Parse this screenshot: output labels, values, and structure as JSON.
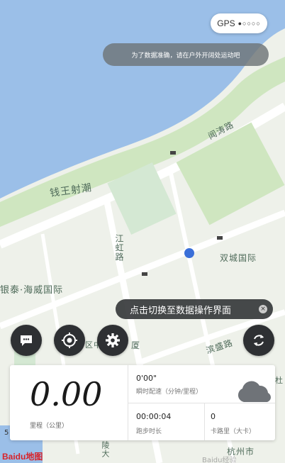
{
  "gps": {
    "label": "GPS",
    "signal_dots": "●○○○○"
  },
  "toast": {
    "text": "为了数据准确，请在户外开阔处运动吧"
  },
  "switch_hint": {
    "text": "点击切换至数据操作界面",
    "close_glyph": "×"
  },
  "map": {
    "labels": {
      "qiantang": "钱王射潮",
      "wenchao_road": "闻涛路",
      "jiangdong_road": "江虹路",
      "shuangcheng": "双城国际",
      "yintai": "银泰·海威国际",
      "binsheng": "滨盛路",
      "hangzhou": "杭州市",
      "jiang_ave": "江陵大",
      "bottom_road": "区中心路",
      "shangxia": "厦",
      "top_corner": "杜",
      "right_fragment": "路"
    },
    "scale_label": "5",
    "logo": "Baidu地图",
    "colors": {
      "water": "#9bbfe8",
      "park": "#cfe6c0",
      "road": "#ffffff",
      "land": "#eef1ea"
    }
  },
  "buttons": {
    "chat_icon": "chat-icon",
    "locate_icon": "target-icon",
    "settings_icon": "gear-icon",
    "rotate_icon": "rotate-icon"
  },
  "stats": {
    "distance_value": "0.00",
    "distance_label": "里程（公里）",
    "pace_value": "0'00\"",
    "pace_label": "瞬时配速（分钟/里程）",
    "duration_value": "00:00:04",
    "duration_label": "跑步时长",
    "calories_value": "0",
    "calories_label": "卡路里（大卡）",
    "weather_icon": "cloud-icon"
  },
  "watermark": "Baidu经验"
}
